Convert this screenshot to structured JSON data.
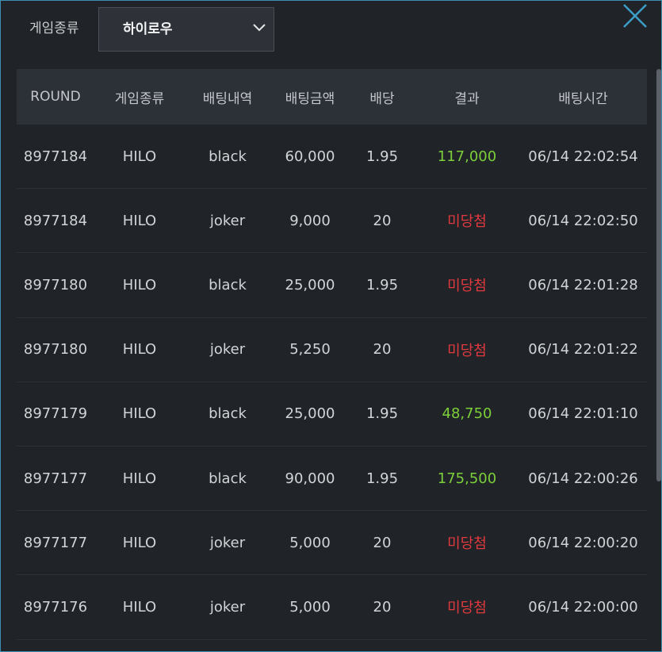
{
  "filter": {
    "label": "게임종류",
    "selected": "하이로우"
  },
  "table": {
    "headers": {
      "round": "ROUND",
      "game": "게임종류",
      "bet": "배팅내역",
      "amount": "배팅금액",
      "odds": "배당",
      "result": "결과",
      "time": "배팅시간"
    },
    "rows": [
      {
        "round": "8977184",
        "game": "HILO",
        "bet": "black",
        "amount": "60,000",
        "odds": "1.95",
        "result": "117,000",
        "time": "06/14 22:02:54"
      },
      {
        "round": "8977184",
        "game": "HILO",
        "bet": "joker",
        "amount": "9,000",
        "odds": "20",
        "result": "미당첨",
        "time": "06/14 22:02:50"
      },
      {
        "round": "8977180",
        "game": "HILO",
        "bet": "black",
        "amount": "25,000",
        "odds": "1.95",
        "result": "미당첨",
        "time": "06/14 22:01:28"
      },
      {
        "round": "8977180",
        "game": "HILO",
        "bet": "joker",
        "amount": "5,250",
        "odds": "20",
        "result": "미당첨",
        "time": "06/14 22:01:22"
      },
      {
        "round": "8977179",
        "game": "HILO",
        "bet": "black",
        "amount": "25,000",
        "odds": "1.95",
        "result": "48,750",
        "time": "06/14 22:01:10"
      },
      {
        "round": "8977177",
        "game": "HILO",
        "bet": "black",
        "amount": "90,000",
        "odds": "1.95",
        "result": "175,500",
        "time": "06/14 22:00:26"
      },
      {
        "round": "8977177",
        "game": "HILO",
        "bet": "joker",
        "amount": "5,000",
        "odds": "20",
        "result": "미당첨",
        "time": "06/14 22:00:20"
      },
      {
        "round": "8977176",
        "game": "HILO",
        "bet": "joker",
        "amount": "5,000",
        "odds": "20",
        "result": "미당첨",
        "time": "06/14 22:00:00"
      }
    ]
  },
  "colors": {
    "win": "#7ccf3a",
    "lose": "#e0393e",
    "accent": "#3c8fb0"
  },
  "icons": {
    "close": "close-icon",
    "dropdown": "chevron-down-icon"
  }
}
